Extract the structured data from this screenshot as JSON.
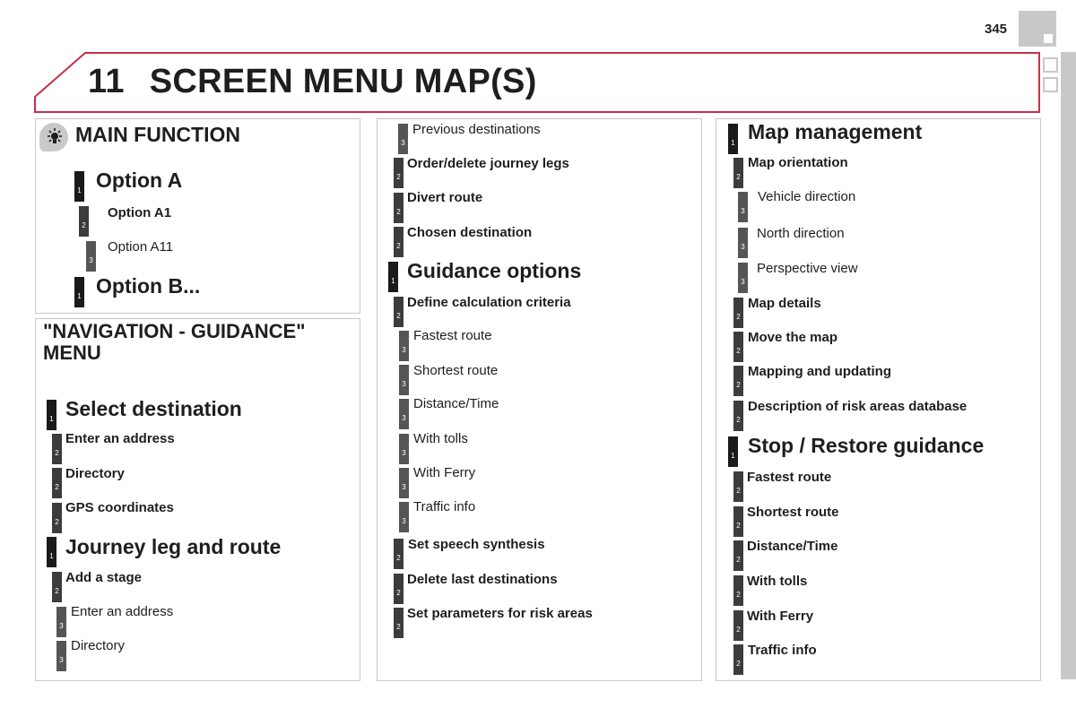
{
  "page": {
    "number": "345",
    "chapter_number": "11",
    "chapter_title": "SCREEN MENU MAP(S)",
    "accent_color": "#c4314b"
  },
  "legend_panel": {
    "title": "MAIN FUNCTION",
    "icon": "navigation-lightbulb-icon",
    "items": [
      {
        "level": "1",
        "label": "Option A"
      },
      {
        "level": "2",
        "label": "Option A1"
      },
      {
        "level": "3",
        "label": "Option A11"
      },
      {
        "level": "1",
        "label": "Option B..."
      }
    ]
  },
  "nav_panel": {
    "title_line1": "\"NAVIGATION - GUIDANCE\"",
    "title_line2": "MENU",
    "items": [
      {
        "level": "1",
        "label": "Select destination"
      },
      {
        "level": "2",
        "label": "Enter an address"
      },
      {
        "level": "2",
        "label": "Directory"
      },
      {
        "level": "2",
        "label": "GPS coordinates"
      },
      {
        "level": "1",
        "label": "Journey leg and route"
      },
      {
        "level": "2",
        "label": "Add a stage"
      },
      {
        "level": "3",
        "label": "Enter an address"
      },
      {
        "level": "3",
        "label": "Directory"
      }
    ]
  },
  "middle_panel": {
    "items": [
      {
        "level": "3",
        "label": "Previous destinations"
      },
      {
        "level": "2",
        "label": "Order/delete journey legs"
      },
      {
        "level": "2",
        "label": "Divert route"
      },
      {
        "level": "2",
        "label": "Chosen destination"
      },
      {
        "level": "1",
        "label": "Guidance options"
      },
      {
        "level": "2",
        "label": "Define calculation criteria"
      },
      {
        "level": "3",
        "label": "Fastest route"
      },
      {
        "level": "3",
        "label": "Shortest route"
      },
      {
        "level": "3",
        "label": "Distance/Time"
      },
      {
        "level": "3",
        "label": "With tolls"
      },
      {
        "level": "3",
        "label": "With Ferry"
      },
      {
        "level": "3",
        "label": "Traffic info"
      },
      {
        "level": "2",
        "label": "Set speech synthesis"
      },
      {
        "level": "2",
        "label": "Delete last destinations"
      },
      {
        "level": "2",
        "label": "Set parameters for risk areas"
      }
    ]
  },
  "right_panel": {
    "items": [
      {
        "level": "1",
        "label": "Map management"
      },
      {
        "level": "2",
        "label": "Map orientation"
      },
      {
        "level": "3",
        "label": "Vehicle direction"
      },
      {
        "level": "3",
        "label": "North direction"
      },
      {
        "level": "3",
        "label": "Perspective view"
      },
      {
        "level": "2",
        "label": "Map details"
      },
      {
        "level": "2",
        "label": "Move the map"
      },
      {
        "level": "2",
        "label": "Mapping and updating"
      },
      {
        "level": "2",
        "label": "Description of risk areas database"
      },
      {
        "level": "1",
        "label": "Stop / Restore guidance"
      },
      {
        "level": "2",
        "label": "Fastest route"
      },
      {
        "level": "2",
        "label": "Shortest route"
      },
      {
        "level": "2",
        "label": "Distance/Time"
      },
      {
        "level": "2",
        "label": "With tolls"
      },
      {
        "level": "2",
        "label": "With Ferry"
      },
      {
        "level": "2",
        "label": "Traffic info"
      }
    ]
  }
}
